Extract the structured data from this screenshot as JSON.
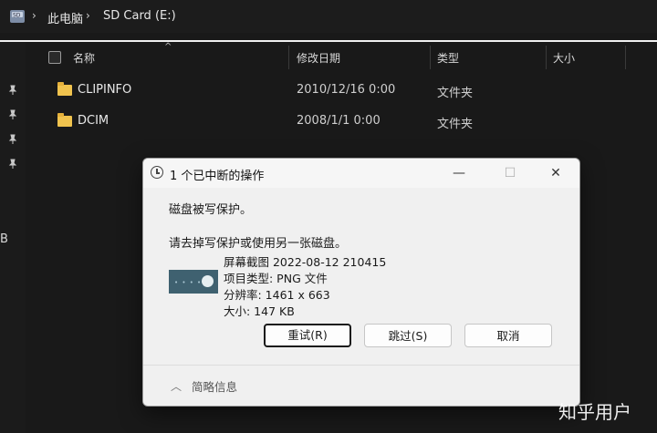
{
  "address_bar": {
    "drive_icon": "sd-card-drive-icon",
    "separator": "›",
    "crumbs": [
      "此电脑",
      "SD Card (E:)"
    ]
  },
  "columns": {
    "name": "名称",
    "modified": "修改日期",
    "type": "类型",
    "size": "大小"
  },
  "rows": [
    {
      "name": "CLIPINFO",
      "date": "2010/12/16 0:00",
      "type": "文件夹"
    },
    {
      "name": "DCIM",
      "date": "2008/1/1 0:00",
      "type": "文件夹"
    }
  ],
  "left_rail": {
    "pin_icon": "pin-icon",
    "partial_text": "B"
  },
  "dialog": {
    "title": "1 个已中断的操作",
    "minimize": "—",
    "maximize": "☐",
    "close": "✕",
    "message1": "磁盘被写保护。",
    "message2": "请去掉写保护或使用另一张磁盘。",
    "file_info": [
      "屏幕截图 2022-08-12 210415",
      "项目类型: PNG 文件",
      "分辨率: 1461 x 663",
      "大小: 147 KB"
    ],
    "buttons": {
      "retry": "重试(R)",
      "skip": "跳过(S)",
      "cancel": "取消"
    },
    "footer_label": "简略信息"
  },
  "watermark": "知乎用户",
  "colors": {
    "background": "#191919",
    "dialog_bg": "#f0f0f0",
    "folder": "#f0c34e"
  }
}
